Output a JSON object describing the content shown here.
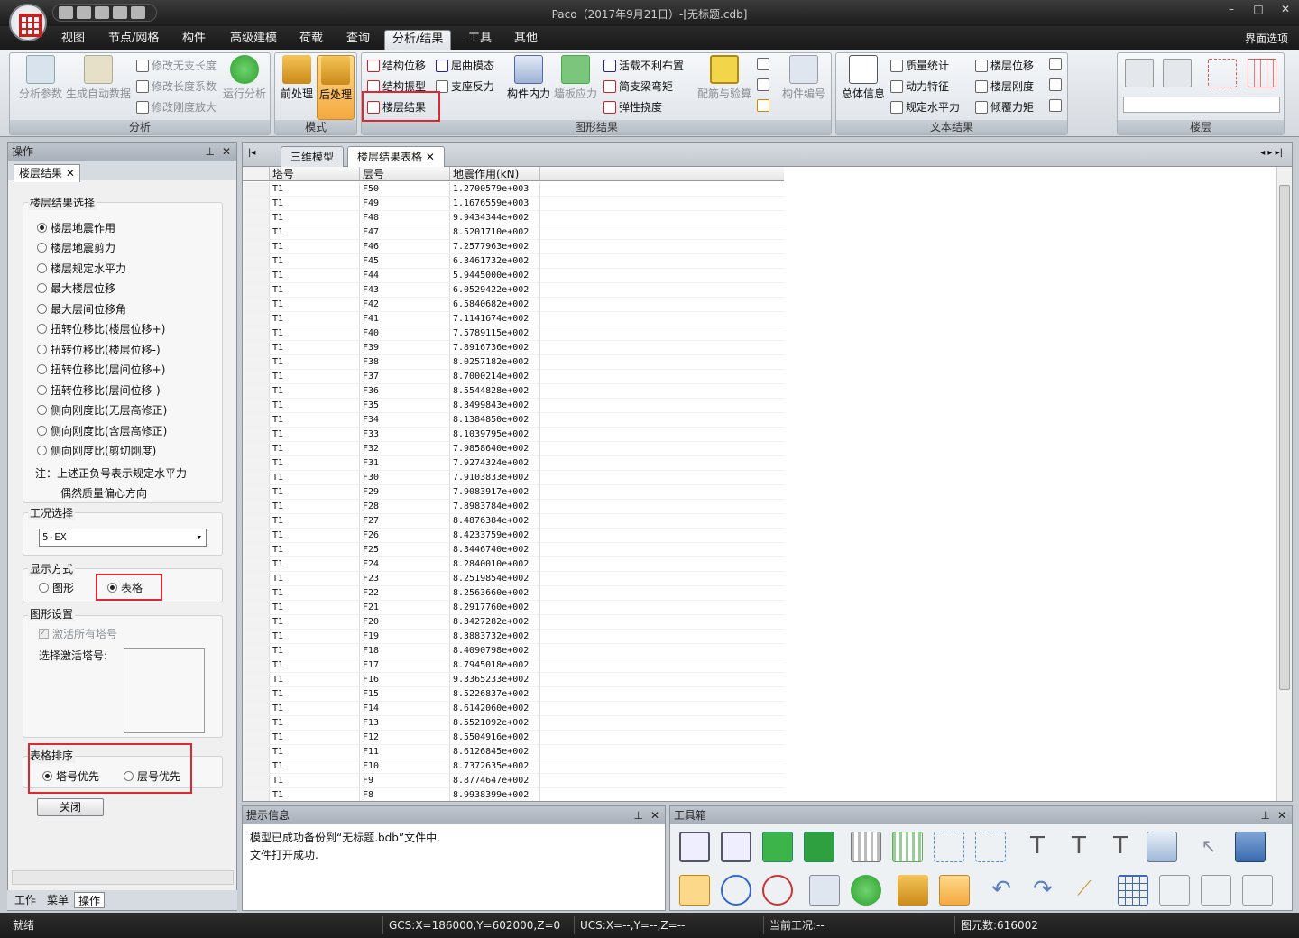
{
  "window": {
    "title": "Paco（2017年9月21日）-[无标题.cdb]"
  },
  "menubar": {
    "tabs": [
      {
        "label": "视图"
      },
      {
        "label": "节点/网格"
      },
      {
        "label": "构件"
      },
      {
        "label": "高级建模"
      },
      {
        "label": "荷载"
      },
      {
        "label": "查询"
      },
      {
        "label": "分析/结果"
      },
      {
        "label": "工具"
      },
      {
        "label": "其他"
      }
    ],
    "active_index": 6,
    "ui_options": "界面选项"
  },
  "ribbon": {
    "analysis": {
      "title": "分析",
      "params": "分析参数",
      "autogen": "生成自动数据",
      "mod_unbraced": "修改无支长度",
      "mod_length_coef": "修改长度系数",
      "mod_stiff_amp": "修改刚度放大",
      "run": "运行分析"
    },
    "mode": {
      "title": "模式",
      "pre": "前处理",
      "post": "后处理"
    },
    "graphic": {
      "title": "图形结果",
      "struct_disp": "结构位移",
      "struct_mode": "结构振型",
      "floor_results": "楼层结果",
      "buckling": "屈曲模态",
      "support_react": "支座反力",
      "member_force": "构件内力",
      "wall_stress": "墙板应力",
      "live_unfav": "活载不利布置",
      "simple_moment": "简支梁弯矩",
      "elastic_defl": "弹性挠度",
      "rebar_check": "配筋与验算",
      "member_no": "构件编号"
    },
    "text": {
      "title": "文本结果",
      "summary": "总体信息",
      "mass": "质量统计",
      "dynamic": "动力特征",
      "spec_force": "规定水平力",
      "floor_disp": "楼层位移",
      "floor_stiff": "楼层刚度",
      "overturn": "倾覆力矩"
    },
    "floor": {
      "title": "楼层"
    }
  },
  "left_panel": {
    "header": "操作",
    "tab": "楼层结果",
    "select_title": "楼层结果选择",
    "options": [
      "楼层地震作用",
      "楼层地震剪力",
      "楼层规定水平力",
      "最大楼层位移",
      "最大层间位移角",
      "扭转位移比(楼层位移+)",
      "扭转位移比(楼层位移-)",
      "扭转位移比(层间位移+)",
      "扭转位移比(层间位移-)",
      "侧向刚度比(无层高修正)",
      "侧向刚度比(含层高修正)",
      "侧向刚度比(剪切刚度)"
    ],
    "note1": "注：上述正负号表示规定水平力",
    "note2": "偶然质量偏心方向",
    "case_title": "工况选择",
    "case_value": "5-EX",
    "display_title": "显示方式",
    "display_graph": "图形",
    "display_table": "表格",
    "gset_title": "图形设置",
    "activate_all": "激活所有塔号",
    "select_active": "选择激活塔号:",
    "sort_title": "表格排序",
    "sort_tower": "塔号优先",
    "sort_floor": "层号优先",
    "close": "关闭",
    "bottom_tabs": [
      "工作",
      "菜单",
      "操作"
    ]
  },
  "doc": {
    "tabs": [
      "三维模型",
      "楼层结果表格"
    ],
    "columns": [
      "塔号",
      "层号",
      "地震作用(kN)"
    ],
    "rows": [
      [
        "T1",
        "F50",
        "1.2700579e+003"
      ],
      [
        "T1",
        "F49",
        "1.1676559e+003"
      ],
      [
        "T1",
        "F48",
        "9.9434344e+002"
      ],
      [
        "T1",
        "F47",
        "8.5201710e+002"
      ],
      [
        "T1",
        "F46",
        "7.2577963e+002"
      ],
      [
        "T1",
        "F45",
        "6.3461732e+002"
      ],
      [
        "T1",
        "F44",
        "5.9445000e+002"
      ],
      [
        "T1",
        "F43",
        "6.0529422e+002"
      ],
      [
        "T1",
        "F42",
        "6.5840682e+002"
      ],
      [
        "T1",
        "F41",
        "7.1141674e+002"
      ],
      [
        "T1",
        "F40",
        "7.5789115e+002"
      ],
      [
        "T1",
        "F39",
        "7.8916736e+002"
      ],
      [
        "T1",
        "F38",
        "8.0257182e+002"
      ],
      [
        "T1",
        "F37",
        "8.7000214e+002"
      ],
      [
        "T1",
        "F36",
        "8.5544828e+002"
      ],
      [
        "T1",
        "F35",
        "8.3499843e+002"
      ],
      [
        "T1",
        "F34",
        "8.1384850e+002"
      ],
      [
        "T1",
        "F33",
        "8.1039795e+002"
      ],
      [
        "T1",
        "F32",
        "7.9858640e+002"
      ],
      [
        "T1",
        "F31",
        "7.9274324e+002"
      ],
      [
        "T1",
        "F30",
        "7.9103833e+002"
      ],
      [
        "T1",
        "F29",
        "7.9083917e+002"
      ],
      [
        "T1",
        "F28",
        "7.8983784e+002"
      ],
      [
        "T1",
        "F27",
        "8.4876384e+002"
      ],
      [
        "T1",
        "F26",
        "8.4233759e+002"
      ],
      [
        "T1",
        "F25",
        "8.3446740e+002"
      ],
      [
        "T1",
        "F24",
        "8.2840010e+002"
      ],
      [
        "T1",
        "F23",
        "8.2519854e+002"
      ],
      [
        "T1",
        "F22",
        "8.2563660e+002"
      ],
      [
        "T1",
        "F21",
        "8.2917760e+002"
      ],
      [
        "T1",
        "F20",
        "8.3427282e+002"
      ],
      [
        "T1",
        "F19",
        "8.3883732e+002"
      ],
      [
        "T1",
        "F18",
        "8.4090798e+002"
      ],
      [
        "T1",
        "F17",
        "8.7945018e+002"
      ],
      [
        "T1",
        "F16",
        "9.3365233e+002"
      ],
      [
        "T1",
        "F15",
        "8.5226837e+002"
      ],
      [
        "T1",
        "F14",
        "8.6142060e+002"
      ],
      [
        "T1",
        "F13",
        "8.5521092e+002"
      ],
      [
        "T1",
        "F12",
        "8.5504916e+002"
      ],
      [
        "T1",
        "F11",
        "8.6126845e+002"
      ],
      [
        "T1",
        "F10",
        "8.7372635e+002"
      ],
      [
        "T1",
        "F9",
        "8.8774647e+002"
      ],
      [
        "T1",
        "F8",
        "8.9938399e+002"
      ]
    ]
  },
  "info": {
    "header": "提示信息",
    "line1": "模型已成功备份到“无标题.bdb”文件中.",
    "line2": "文件打开成功."
  },
  "toolbox": {
    "header": "工具箱"
  },
  "status": {
    "ready": "就绪",
    "gcs": "GCS:X=186000,Y=602000,Z=0",
    "ucs": "UCS:X=--,Y=--,Z=--",
    "case": "当前工况:--",
    "count": "图元数:616002"
  }
}
